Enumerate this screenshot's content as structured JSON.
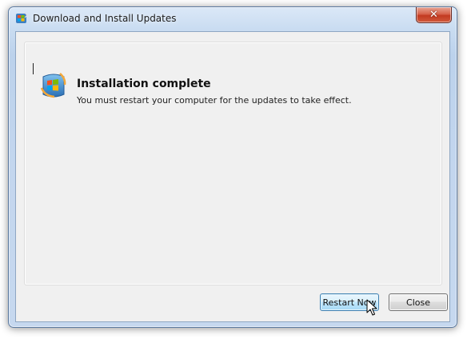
{
  "window": {
    "title": "Download and Install Updates",
    "close_glyph": "✕"
  },
  "status": {
    "heading": "Installation complete",
    "message": "You must restart your computer for the updates to take effect."
  },
  "buttons": {
    "restart_label": "Restart Now",
    "close_label": "Close"
  },
  "icons": {
    "title_icon": "windows-update-icon",
    "status_icon": "windows-update-icon",
    "cursor": "mouse-pointer-icon"
  },
  "colors": {
    "close_button": "#c23a21",
    "default_button_border": "#3c7fb1",
    "frame_border": "#5c7aa0"
  }
}
